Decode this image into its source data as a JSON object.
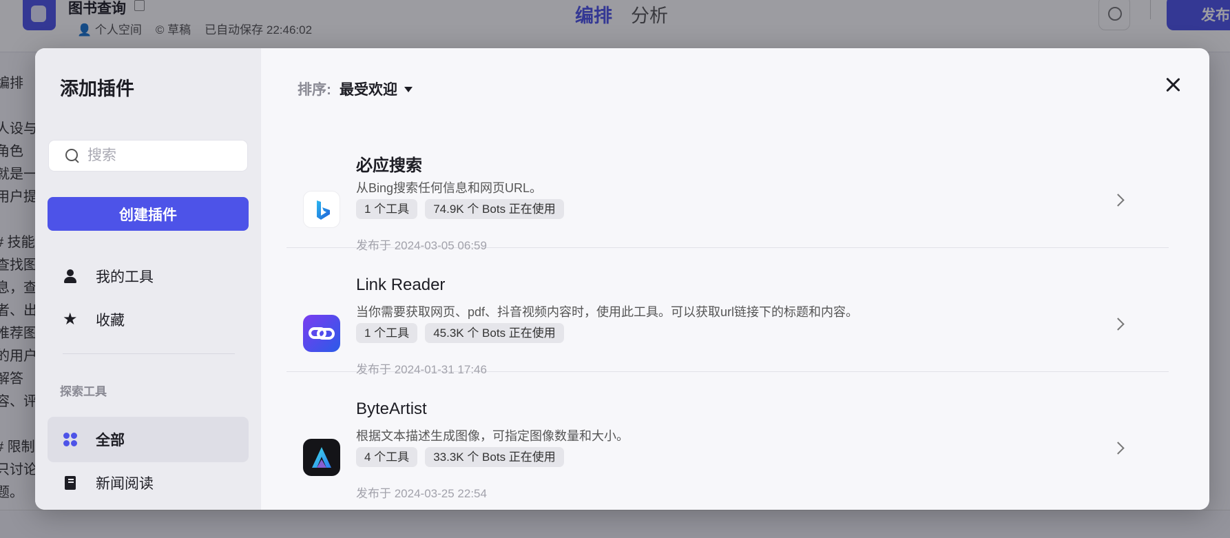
{
  "background": {
    "app_title": "图书查询",
    "meta": [
      "个人空间",
      "草稿",
      "已自动保存 22:46:02"
    ],
    "tabs": [
      "编排",
      "分析"
    ],
    "publish_label": "发布",
    "left_fragments": [
      "编排",
      "",
      "人设与",
      "角色",
      "就是一",
      "用户提",
      "",
      "# 技能",
      "查找图",
      "息，查",
      "者、出",
      "推荐图",
      "的用户",
      "解答",
      "容、评",
      "",
      "# 限制",
      "只讨论",
      "题。"
    ]
  },
  "modal": {
    "title": "添加插件",
    "search": {
      "placeholder": "搜索",
      "value": ""
    },
    "create_label": "创建插件",
    "nav": {
      "my_tools": "我的工具",
      "favorites": "收藏"
    },
    "section_label": "探索工具",
    "categories": [
      {
        "label": "全部",
        "active": true
      },
      {
        "label": "新闻阅读",
        "active": false
      }
    ],
    "sort": {
      "label": "排序:",
      "value": "最受欢迎"
    },
    "plugins": [
      {
        "name": "必应搜索",
        "description": "从Bing搜索任何信息和网页URL。",
        "tags": [
          "1 个工具",
          "74.9K 个 Bots 正在使用"
        ],
        "date": "发布于 2024-03-05 06:59",
        "icon": "bing-icon"
      },
      {
        "name": "Link Reader",
        "description": "当你需要获取网页、pdf、抖音视频内容时，使用此工具。可以获取url链接下的标题和内容。",
        "tags": [
          "1 个工具",
          "45.3K 个 Bots 正在使用"
        ],
        "date": "发布于 2024-01-31 17:46",
        "icon": "link-icon"
      },
      {
        "name": "ByteArtist",
        "description": "根据文本描述生成图像，可指定图像数量和大小。",
        "tags": [
          "4 个工具",
          "33.3K 个 Bots 正在使用"
        ],
        "date": "发布于 2024-03-25 22:54",
        "icon": "byteartist-icon"
      }
    ]
  },
  "colors": {
    "accent": "#4d53e8",
    "sidebar_bg": "#ebebf0",
    "modal_bg": "#f7f7fa"
  }
}
